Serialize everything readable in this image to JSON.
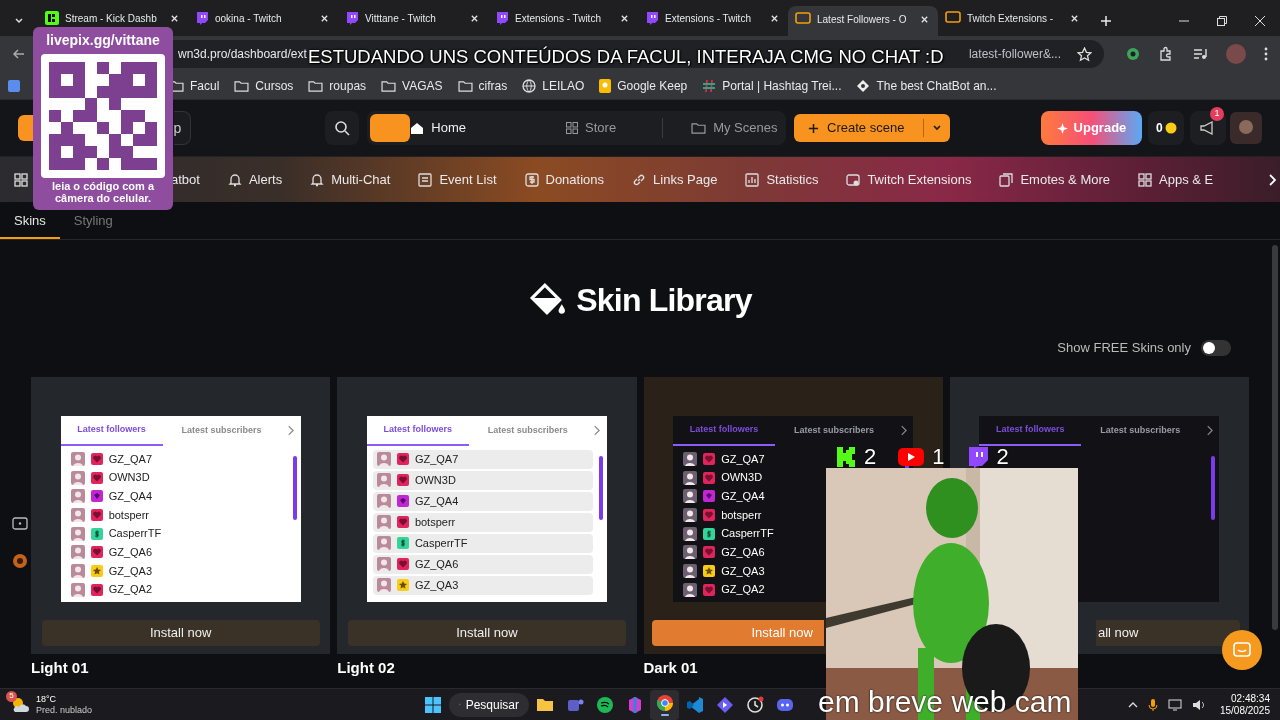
{
  "browser": {
    "tabs": [
      {
        "label": "Stream - Kick Dashb",
        "kind": "kick",
        "selected": false
      },
      {
        "label": "ookina - Twitch",
        "kind": "twitch",
        "selected": false
      },
      {
        "label": "Vitttane - Twitch",
        "kind": "twitch",
        "selected": false
      },
      {
        "label": "Extensions - Twitch",
        "kind": "twitch",
        "selected": false
      },
      {
        "label": "Extensions - Twitch",
        "kind": "twitch",
        "selected": false
      },
      {
        "label": "Latest Followers - O",
        "kind": "own3d",
        "selected": true
      },
      {
        "label": "Twitch Extensions -",
        "kind": "own3d",
        "selected": false
      }
    ],
    "url_start": "wn3d.pro/dashboard/ext",
    "url_end": "latest-follower&...",
    "bookmarks": [
      {
        "label": "Facul",
        "kind": "folder"
      },
      {
        "label": "Cursos",
        "kind": "folder"
      },
      {
        "label": "roupas",
        "kind": "folder"
      },
      {
        "label": "VAGAS",
        "kind": "folder"
      },
      {
        "label": "cifras",
        "kind": "folder"
      },
      {
        "label": "LEILAO",
        "kind": "globe"
      },
      {
        "label": "Google Keep",
        "kind": "note"
      },
      {
        "label": "Portal | Hashtag Trei...",
        "kind": "hashtag"
      },
      {
        "label": "The best ChatBot an...",
        "kind": "diamond"
      }
    ]
  },
  "app": {
    "left_button": "p",
    "home": "Home",
    "store": "Store",
    "my_scenes": "My Scenes",
    "create": "Create scene",
    "upgrade": "Upgrade",
    "coins": "0",
    "notifications": "1"
  },
  "nav": [
    {
      "label": "atbot"
    },
    {
      "label": "Alerts",
      "kind": "bell"
    },
    {
      "label": "Multi-Chat",
      "kind": "bell"
    },
    {
      "label": "Event List",
      "kind": "list"
    },
    {
      "label": "Donations",
      "kind": "dollar"
    },
    {
      "label": "Links Page",
      "kind": "link"
    },
    {
      "label": "Statistics",
      "kind": "chart"
    },
    {
      "label": "Twitch Extensions",
      "kind": "ext"
    },
    {
      "label": "Emotes & More",
      "kind": "emote"
    },
    {
      "label": "Apps & E",
      "kind": "grid"
    }
  ],
  "subtabs": [
    {
      "label": "Skins",
      "selected": true
    },
    {
      "label": "Styling",
      "selected": false
    }
  ],
  "title": "Skin Library",
  "free_toggle": {
    "label": "Show FREE Skins only",
    "on": false
  },
  "skins": [
    {
      "name": "Light 01",
      "kind": "light",
      "hovered": false,
      "tabs": [
        "Latest followers",
        "Latest subscribers"
      ],
      "button": "Install now",
      "entries": [
        {
          "name": "GZ_QA7",
          "kind": "heart"
        },
        {
          "name": "OWN3D",
          "kind": "heart"
        },
        {
          "name": "GZ_QA4",
          "kind": "gem"
        },
        {
          "name": "botsperr",
          "kind": "heart"
        },
        {
          "name": "CasperrTF",
          "kind": "dollar"
        },
        {
          "name": "GZ_QA6",
          "kind": "heart"
        },
        {
          "name": "GZ_QA3",
          "kind": "star"
        },
        {
          "name": "GZ_QA2",
          "kind": "heart"
        }
      ]
    },
    {
      "name": "Light 02",
      "kind": "light-striped",
      "hovered": false,
      "tabs": [
        "Latest followers",
        "Latest subscribers"
      ],
      "button": "Install now",
      "entries": [
        {
          "name": "GZ_QA7",
          "kind": "heart"
        },
        {
          "name": "OWN3D",
          "kind": "heart"
        },
        {
          "name": "GZ_QA4",
          "kind": "gem"
        },
        {
          "name": "botsperr",
          "kind": "heart"
        },
        {
          "name": "CasperrTF",
          "kind": "dollar"
        },
        {
          "name": "GZ_QA6",
          "kind": "heart"
        },
        {
          "name": "GZ_QA3",
          "kind": "star"
        }
      ]
    },
    {
      "name": "Dark 01",
      "kind": "dark",
      "hovered": true,
      "tabs": [
        "Latest followers",
        "Latest subscribers"
      ],
      "button": "Install now",
      "entries": [
        {
          "name": "GZ_QA7",
          "kind": "heart"
        },
        {
          "name": "OWN3D",
          "kind": "heart"
        },
        {
          "name": "GZ_QA4",
          "kind": "gem"
        },
        {
          "name": "botsperr",
          "kind": "heart"
        },
        {
          "name": "CasperrTF",
          "kind": "dollar"
        },
        {
          "name": "GZ_QA6",
          "kind": "heart"
        },
        {
          "name": "GZ_QA3",
          "kind": "star"
        },
        {
          "name": "GZ_QA2",
          "kind": "heart"
        }
      ]
    },
    {
      "kind": "dark-striped",
      "hovered": false,
      "tabs": [
        "Latest followers",
        "Latest subscribers"
      ],
      "button": "all now"
    }
  ],
  "overlay": {
    "qr": {
      "url": "livepix.gg/vittane",
      "hint": "leia o código com a câmera do celular."
    },
    "caption": "ESTUDANDO UNS CONTEÚDOS DA FACUL, INTERAJA CMG NO CHAT :D",
    "viewers": [
      {
        "kind": "kick",
        "count": "2"
      },
      {
        "kind": "youtube",
        "count": "1"
      },
      {
        "kind": "twitch",
        "count": "2"
      }
    ],
    "footer": "em breve web cam"
  },
  "taskbar": {
    "weather": {
      "temp": "18°C",
      "forecast": "Pred. nublado",
      "badge": "5"
    },
    "search": "Pesquisar",
    "apps": [
      {
        "kind": "files",
        "active": false
      },
      {
        "kind": "teams",
        "active": false
      },
      {
        "kind": "music",
        "active": false
      },
      {
        "kind": "office",
        "active": false
      },
      {
        "kind": "browser",
        "active": true
      },
      {
        "kind": "code",
        "active": false
      },
      {
        "kind": "launcher",
        "active": false
      },
      {
        "kind": "timer",
        "active": false
      },
      {
        "kind": "discord",
        "active": false
      }
    ],
    "time": "02:48:34",
    "date": "15/08/2025"
  }
}
